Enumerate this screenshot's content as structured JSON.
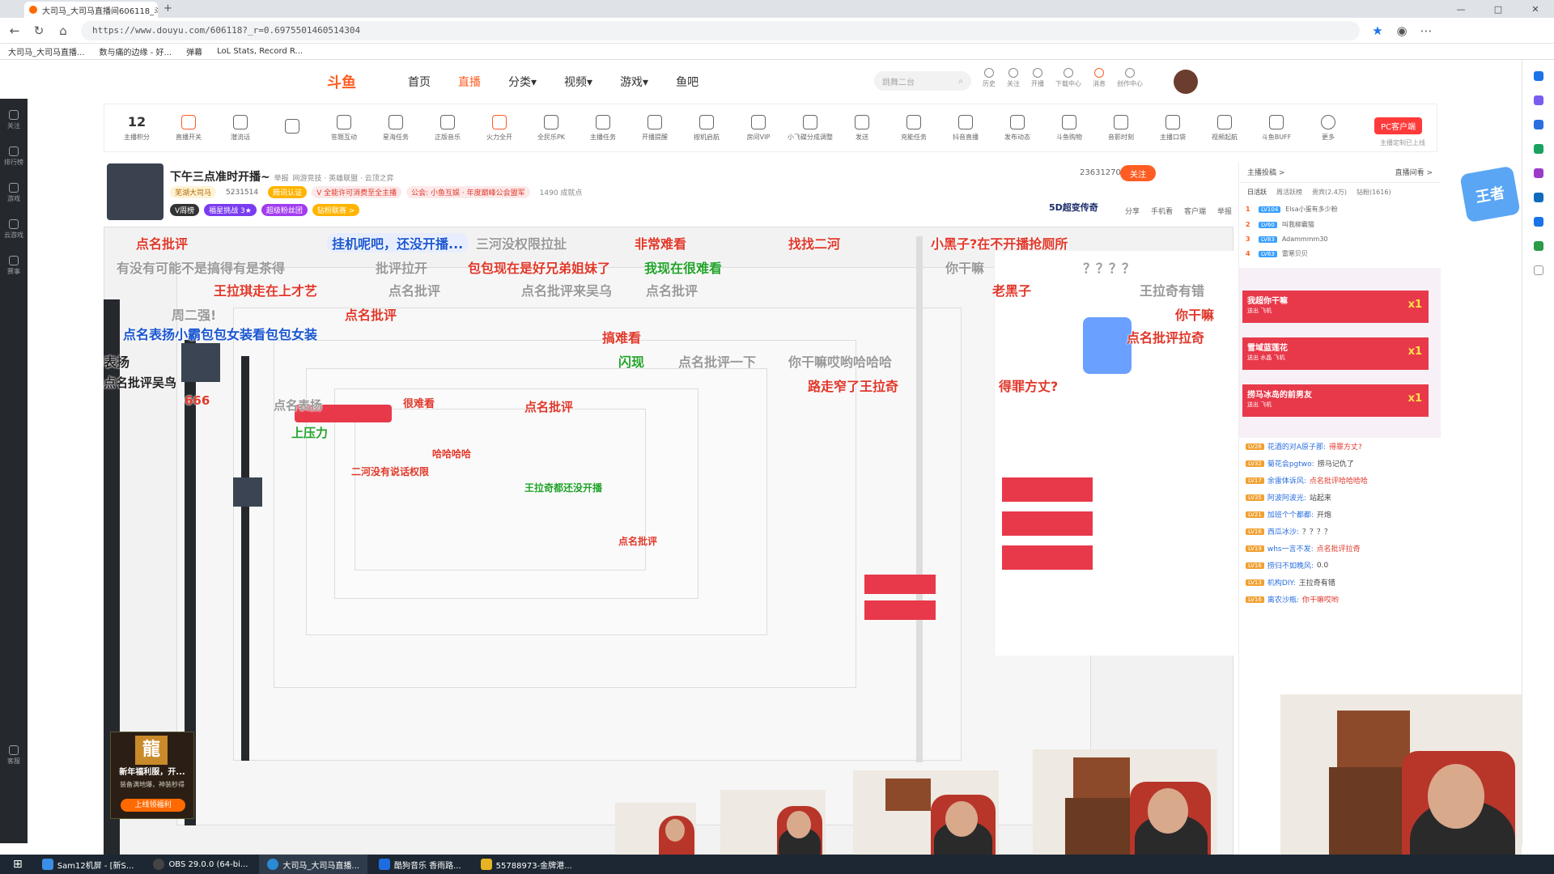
{
  "browser": {
    "tab_title": "大司马_大司马直播间606118_斗鱼",
    "url": "https://www.douyu.com/606118?_r=0.6975501460514304",
    "bookmarks": [
      "大司马_大司马直播...",
      "数与痛的边缘 - 好...",
      "弹幕",
      "LoL Stats, Record R..."
    ],
    "window_controls": [
      "—",
      "□",
      "✕"
    ]
  },
  "site": {
    "logo": "斗鱼",
    "nav": [
      "首页",
      "直播",
      "分类▾",
      "视频▾",
      "游戏▾",
      "鱼吧"
    ],
    "active_nav": "直播",
    "search_placeholder": "跳舞二台",
    "user_tools": [
      "历史",
      "关注",
      "开播",
      "下载中心",
      "消息",
      "创作中心"
    ]
  },
  "left_sidebar": [
    "关注",
    "排行榜",
    "游戏",
    "云游戏",
    "赛事",
    "客服"
  ],
  "toolbar": {
    "score": "12",
    "items": [
      "主播积分",
      "直播开关",
      "潜流话",
      "",
      "答题互动",
      "星海任务",
      "正版音乐",
      "火力全开",
      "全民乐PK",
      "主播任务",
      "开播提醒",
      "按机启航",
      "房间VIP",
      "小飞碟分成调整",
      "发送",
      "充能任务",
      "抖音直播",
      "发布动态",
      "斗鱼购物",
      "音影时刻",
      "主播口袋",
      "视频起航",
      "斗鱼BUFF",
      "更多"
    ],
    "pc_button": "PC客户端",
    "pc_sub": "主播定制已上线"
  },
  "stream": {
    "title": "下午三点准时开播~",
    "report": "举报",
    "category": "网游竞技 · 英雄联盟 · 云顶之弈",
    "streamer": "芜湖大司马",
    "fans": "5231514",
    "badge_cert": "腾讯认证",
    "notice": "V 全能许可消费至全主播",
    "announce": "公会: 小鱼互娱 · 年度巅峰公会盟军",
    "online": "1490 成就点",
    "hot": "23631270",
    "follow": "关注",
    "tags": [
      "V周榜",
      "福星挑战 3★",
      "超级粉丝团",
      "钻粉联赛 >"
    ],
    "share": [
      "分享",
      "手机看",
      "客户端",
      "举报"
    ],
    "fd_text": "5D超变传奇"
  },
  "danmaku": [
    {
      "t": "点名批评",
      "c": "#e0382a"
    },
    {
      "t": "挂机呢吧，还没开播...",
      "c": "#1a56d0"
    },
    {
      "t": "三河没权限拉扯",
      "c": "#999999"
    },
    {
      "t": "非常难看",
      "c": "#e0382a"
    },
    {
      "t": "找找二河",
      "c": "#e0382a"
    },
    {
      "t": "小黑子?在不开播抢厕所",
      "c": "#e0382a"
    },
    {
      "t": "有没有可能不是搞得有是茶得",
      "c": "#999999"
    },
    {
      "t": "批评拉开",
      "c": "#999999"
    },
    {
      "t": "包包现在是好兄弟姐妹了",
      "c": "#e0382a"
    },
    {
      "t": "我现在很难看",
      "c": "#22a32a"
    },
    {
      "t": "你干嘛",
      "c": "#999999"
    },
    {
      "t": "？？？？",
      "c": "#999999"
    },
    {
      "t": "王拉琪走在上才艺",
      "c": "#e0382a"
    },
    {
      "t": "点名批评",
      "c": "#999999"
    },
    {
      "t": "点名批评来吴乌",
      "c": "#999999"
    },
    {
      "t": "点名批评",
      "c": "#999999"
    },
    {
      "t": "老黑子",
      "c": "#e0382a"
    },
    {
      "t": "王拉奇有错",
      "c": "#999999"
    },
    {
      "t": "点名表扬小霸包包女装看包包女装",
      "c": "#1a56d0"
    },
    {
      "t": "搞难看",
      "c": "#e0382a"
    },
    {
      "t": "点名批评拉奇",
      "c": "#e0382a"
    },
    {
      "t": "点名批评",
      "c": "#e0382a"
    },
    {
      "t": "你干嘛",
      "c": "#e0382a"
    },
    {
      "t": "周二强!",
      "c": "#999999"
    },
    {
      "t": "闪现",
      "c": "#22a32a"
    },
    {
      "t": "点名批评一下",
      "c": "#999999"
    },
    {
      "t": "你干嘛哎哟哈哈哈",
      "c": "#999999"
    },
    {
      "t": "路走窄了王拉奇",
      "c": "#e0382a"
    },
    {
      "t": "得罪方丈?",
      "c": "#e0382a"
    },
    {
      "t": "表扬",
      "c": "#222222"
    },
    {
      "t": "点名批评吴鸟",
      "c": "#222222"
    },
    {
      "t": "点名表扬",
      "c": "#999999"
    },
    {
      "t": "二河没有说话权限",
      "c": "#e0382a"
    },
    {
      "t": "哈哈哈哈",
      "c": "#e0382a"
    },
    {
      "t": "上压力",
      "c": "#22a32a"
    },
    {
      "t": "点名批评",
      "c": "#e0382a"
    },
    {
      "t": "王拉奇都还没开播",
      "c": "#22a32a"
    },
    {
      "t": "666",
      "c": "#e0382a"
    },
    {
      "t": "很难看",
      "c": "#e0382a"
    },
    {
      "t": "点名批评",
      "c": "#e0382a"
    }
  ],
  "chat": {
    "tabs": [
      "主播投稿 >",
      "直播间看 >"
    ],
    "rank_tabs": [
      "日活跃",
      "周活跃榜",
      "贵宾(2.4万)",
      "钻粉(1616)"
    ],
    "ranks": [
      {
        "n": "1",
        "lv": "LV104",
        "name": "Elsa小蛋有多少粉"
      },
      {
        "n": "2",
        "lv": "LV60",
        "name": "叫我柳霸猫"
      },
      {
        "n": "3",
        "lv": "LV83",
        "name": "Adammmm30"
      },
      {
        "n": "4",
        "lv": "LV63",
        "name": "雷寒贝贝"
      }
    ],
    "gifts": [
      {
        "text": "我超你干嘛",
        "sub": "送出 飞机",
        "count": "x1"
      },
      {
        "text": "雪域蓝莲花",
        "sub": "送出 水晶 飞机",
        "count": "x1"
      },
      {
        "text": "捞马冰岛的前男友",
        "sub": "送出 飞机",
        "count": "x1"
      }
    ],
    "messages": [
      {
        "lv": "LV26",
        "user": "花酒的对A原子那:",
        "text": "得罪方丈?",
        "c": "cr"
      },
      {
        "lv": "LV32",
        "user": "菊花会pgtwo:",
        "text": "捞马记仇了",
        "c": ""
      },
      {
        "lv": "LV17",
        "user": "余雷体诉风:",
        "text": "点名批评哈哈哈哈",
        "c": "cr"
      },
      {
        "lv": "LV35",
        "user": "阿波阿波光:",
        "text": "站起来",
        "c": ""
      },
      {
        "lv": "LV21",
        "user": "加班个个都都:",
        "text": "开炮",
        "c": ""
      },
      {
        "lv": "LV16",
        "user": "西瓜冰沙:",
        "text": "？？？？",
        "c": ""
      },
      {
        "lv": "LV19",
        "user": "whs一言不发:",
        "text": "点名批评拉奇",
        "c": "cr"
      },
      {
        "lv": "LV16",
        "user": "捞归不如晚风:",
        "text": "0.0",
        "c": ""
      },
      {
        "lv": "LV13",
        "user": "机构DIY:",
        "text": "王拉奇有错",
        "c": ""
      },
      {
        "lv": "LV16",
        "user": "离农沙瓶:",
        "text": "你干嘛哎哟",
        "c": "cr"
      }
    ]
  },
  "ad": {
    "title": "新年福利服，开...",
    "sub": "装备满地爆，神装秒得",
    "button": "上线领福利"
  },
  "taskbar": [
    {
      "label": "Sam12机屏 - [新S...",
      "color": "#3a8ee6"
    },
    {
      "label": "OBS 29.0.0 (64-bi...",
      "color": "#444444"
    },
    {
      "label": "大司马_大司马直播...",
      "color": "#2a8ad4"
    },
    {
      "label": "酷狗音乐 香雨路...",
      "color": "#1d6de0"
    },
    {
      "label": "55788973-金牌港...",
      "color": "#e6b422"
    }
  ]
}
